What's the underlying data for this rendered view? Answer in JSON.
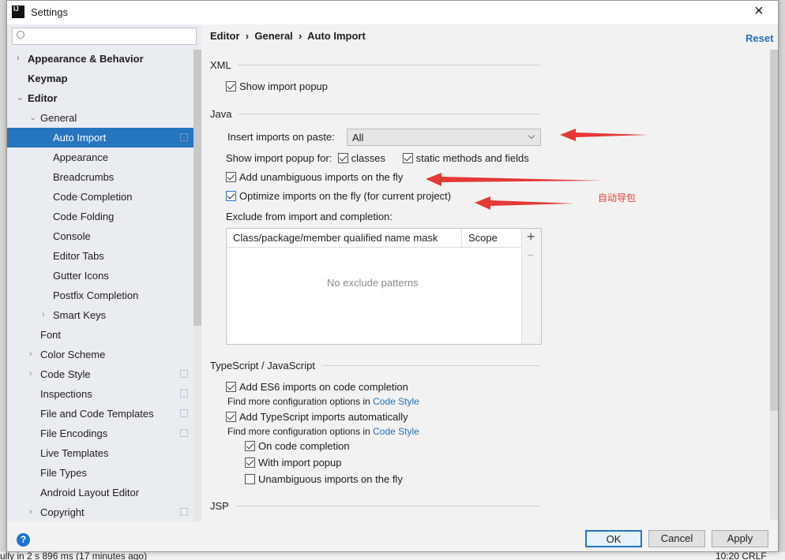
{
  "window": {
    "title": "Settings",
    "close": "×"
  },
  "search": {
    "placeholder": ""
  },
  "sidebar": {
    "items": [
      {
        "label": "Appearance & Behavior",
        "level": 0,
        "bold": true,
        "arrow": "›"
      },
      {
        "label": "Keymap",
        "level": 0,
        "bold": true,
        "arrow": ""
      },
      {
        "label": "Editor",
        "level": 0,
        "bold": true,
        "arrow": "⌄"
      },
      {
        "label": "General",
        "level": 1,
        "arrow": "⌄"
      },
      {
        "label": "Auto Import",
        "level": 2,
        "selected": true,
        "copy": true
      },
      {
        "label": "Appearance",
        "level": 2
      },
      {
        "label": "Breadcrumbs",
        "level": 2
      },
      {
        "label": "Code Completion",
        "level": 2
      },
      {
        "label": "Code Folding",
        "level": 2
      },
      {
        "label": "Console",
        "level": 2
      },
      {
        "label": "Editor Tabs",
        "level": 2
      },
      {
        "label": "Gutter Icons",
        "level": 2
      },
      {
        "label": "Postfix Completion",
        "level": 2
      },
      {
        "label": "Smart Keys",
        "level": 2,
        "arrow": "›"
      },
      {
        "label": "Font",
        "level": 1
      },
      {
        "label": "Color Scheme",
        "level": 1,
        "arrow": "›"
      },
      {
        "label": "Code Style",
        "level": 1,
        "arrow": "›",
        "copy": true
      },
      {
        "label": "Inspections",
        "level": 1,
        "copy": true
      },
      {
        "label": "File and Code Templates",
        "level": 1,
        "copy": true
      },
      {
        "label": "File Encodings",
        "level": 1,
        "copy": true
      },
      {
        "label": "Live Templates",
        "level": 1
      },
      {
        "label": "File Types",
        "level": 1
      },
      {
        "label": "Android Layout Editor",
        "level": 1
      },
      {
        "label": "Copyright",
        "level": 1,
        "arrow": "›",
        "copy": true
      }
    ]
  },
  "breadcrumb": {
    "items": [
      "Editor",
      "General",
      "Auto Import"
    ],
    "separator": "›"
  },
  "reset": "Reset",
  "xml": {
    "title": "XML",
    "show_import_popup": "Show import popup"
  },
  "java": {
    "title": "Java",
    "insert_label": "Insert imports on paste:",
    "insert_value": "All",
    "show_popup_for": "Show import popup for:",
    "classes": "classes",
    "static": "static methods and fields",
    "add_unambiguous": "Add unambiguous imports on the fly",
    "optimize": "Optimize imports on the fly (for current project)",
    "exclude_label": "Exclude from import and completion:",
    "col_mask": "Class/package/member qualified name mask",
    "col_scope": "Scope",
    "empty": "No exclude patterns",
    "add": "+",
    "remove": "−"
  },
  "annotation": {
    "text": "自动导包",
    "color": "#e53935"
  },
  "ts": {
    "title": "TypeScript / JavaScript",
    "es6": "Add ES6 imports on code completion",
    "find_more": "Find more configuration options in",
    "code_style": "Code Style",
    "ts_auto": "Add TypeScript imports automatically",
    "on_completion": "On code completion",
    "with_popup": "With import popup",
    "unambiguous": "Unambiguous imports on the fly"
  },
  "jsp": {
    "title": "JSP"
  },
  "buttons": {
    "ok": "OK",
    "cancel": "Cancel",
    "apply": "Apply",
    "help": "?"
  },
  "background": {
    "status_left": "ully in 2 s 896 ms (17 minutes ago)",
    "status_right": "10:20  CRLF"
  },
  "colors": {
    "accent": "#2675bf",
    "link": "#2470b3",
    "arrow": "#e53935"
  }
}
